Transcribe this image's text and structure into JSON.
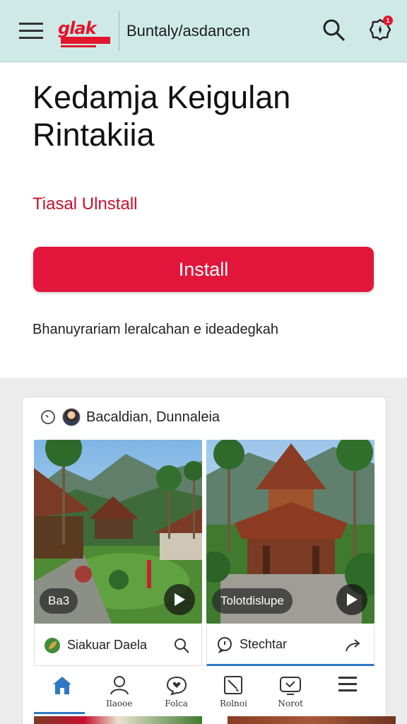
{
  "header": {
    "logo_text": "glak",
    "title": "Buntaly/asdancen",
    "notification_count": "1"
  },
  "hero": {
    "title": "Kedamja Keigulan Rintakiia",
    "subtitle": "Tiasal Ulnstall",
    "install_label": "Install",
    "description": "Bhanuyrariam leralcahan e ideadegkah"
  },
  "card": {
    "author": "Bacaldian, Dunnaleia",
    "media": [
      {
        "label": "Ba3",
        "action_label": "Siakuar Daela"
      },
      {
        "label": "Tolotdislupe",
        "action_label": "Stechtar"
      }
    ]
  },
  "bottom_nav": [
    {
      "label": "",
      "icon": "home-icon"
    },
    {
      "label": "Ilaooe",
      "icon": "person-icon"
    },
    {
      "label": "Folca",
      "icon": "heart-chat-icon"
    },
    {
      "label": "Rolnoi",
      "icon": "edit-icon"
    },
    {
      "label": "Norot",
      "icon": "tv-icon"
    },
    {
      "label": "",
      "icon": "menu-icon"
    }
  ],
  "colors": {
    "accent": "#e2163b",
    "topbar_bg": "#cfeae6",
    "link_blue": "#2f78c4"
  }
}
